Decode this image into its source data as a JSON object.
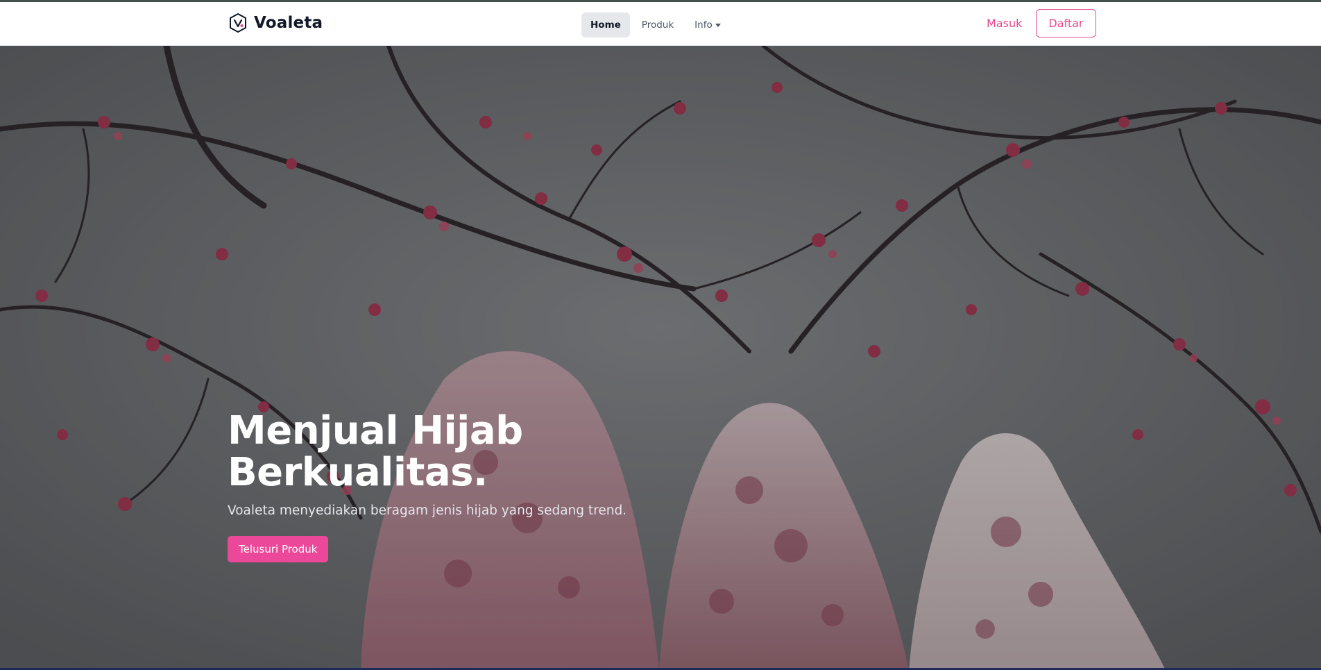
{
  "brand": {
    "name": "Voaleta",
    "logo_icon": "hexagon-v-logo-icon"
  },
  "nav": {
    "items": [
      {
        "label": "Home",
        "active": true
      },
      {
        "label": "Produk",
        "active": false
      },
      {
        "label": "Info",
        "active": false,
        "dropdown": true
      }
    ]
  },
  "auth": {
    "login_label": "Masuk",
    "signup_label": "Daftar"
  },
  "hero": {
    "title_line1": "Menjual Hijab",
    "title_line2": "Berkualitas.",
    "subtitle": "Voaleta menyediakan beragam jenis hijab yang sedang trend.",
    "cta_label": "Telusuri Produk"
  },
  "colors": {
    "accent": "#ec4899",
    "accent_text": "#e8488f",
    "nav_active_bg": "#e5e7eb",
    "text_dark": "#111827"
  }
}
